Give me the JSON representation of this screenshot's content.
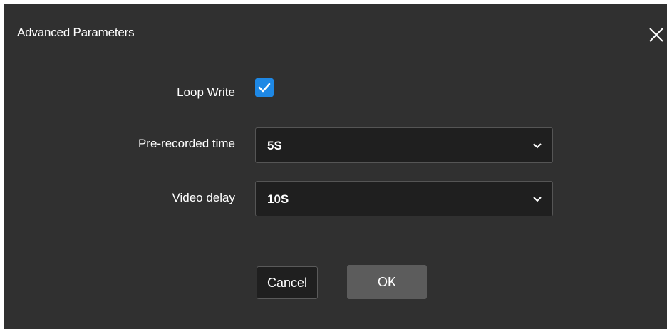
{
  "dialog": {
    "title": "Advanced Parameters",
    "close_icon": "close-icon"
  },
  "fields": {
    "loop_write": {
      "label": "Loop Write",
      "checked": true,
      "check_icon": "checkmark-icon",
      "color": "#1e88e5"
    },
    "pre_recorded_time": {
      "label": "Pre-recorded time",
      "value": "5S",
      "chevron_icon": "chevron-down-icon"
    },
    "video_delay": {
      "label": "Video delay",
      "value": "10S",
      "chevron_icon": "chevron-down-icon"
    }
  },
  "buttons": {
    "cancel_label": "Cancel",
    "ok_label": "OK"
  }
}
